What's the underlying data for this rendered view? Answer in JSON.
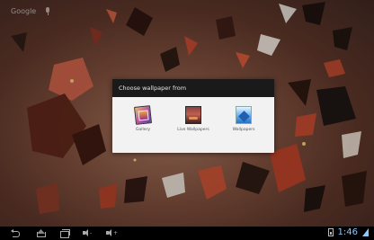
{
  "home": {
    "search_label": "Google"
  },
  "dialog": {
    "title": "Choose wallpaper from",
    "options": [
      {
        "label": "Gallery",
        "icon": "gallery-icon"
      },
      {
        "label": "Live Wallpapers",
        "icon": "live-wallpapers-icon"
      },
      {
        "label": "Wallpapers",
        "icon": "wallpapers-icon"
      }
    ]
  },
  "navbar": {
    "clock": "1:46",
    "icons": [
      "back-icon",
      "home-icon",
      "recents-icon",
      "volume-down-icon",
      "volume-up-icon",
      "battery-icon",
      "signal-icon"
    ]
  },
  "colors": {
    "dialog_header": "#1a1a1a",
    "dialog_body": "#f2f2f2",
    "clock_blue": "#8ec8ff",
    "wallpaper_base": "#7c4e3c"
  }
}
